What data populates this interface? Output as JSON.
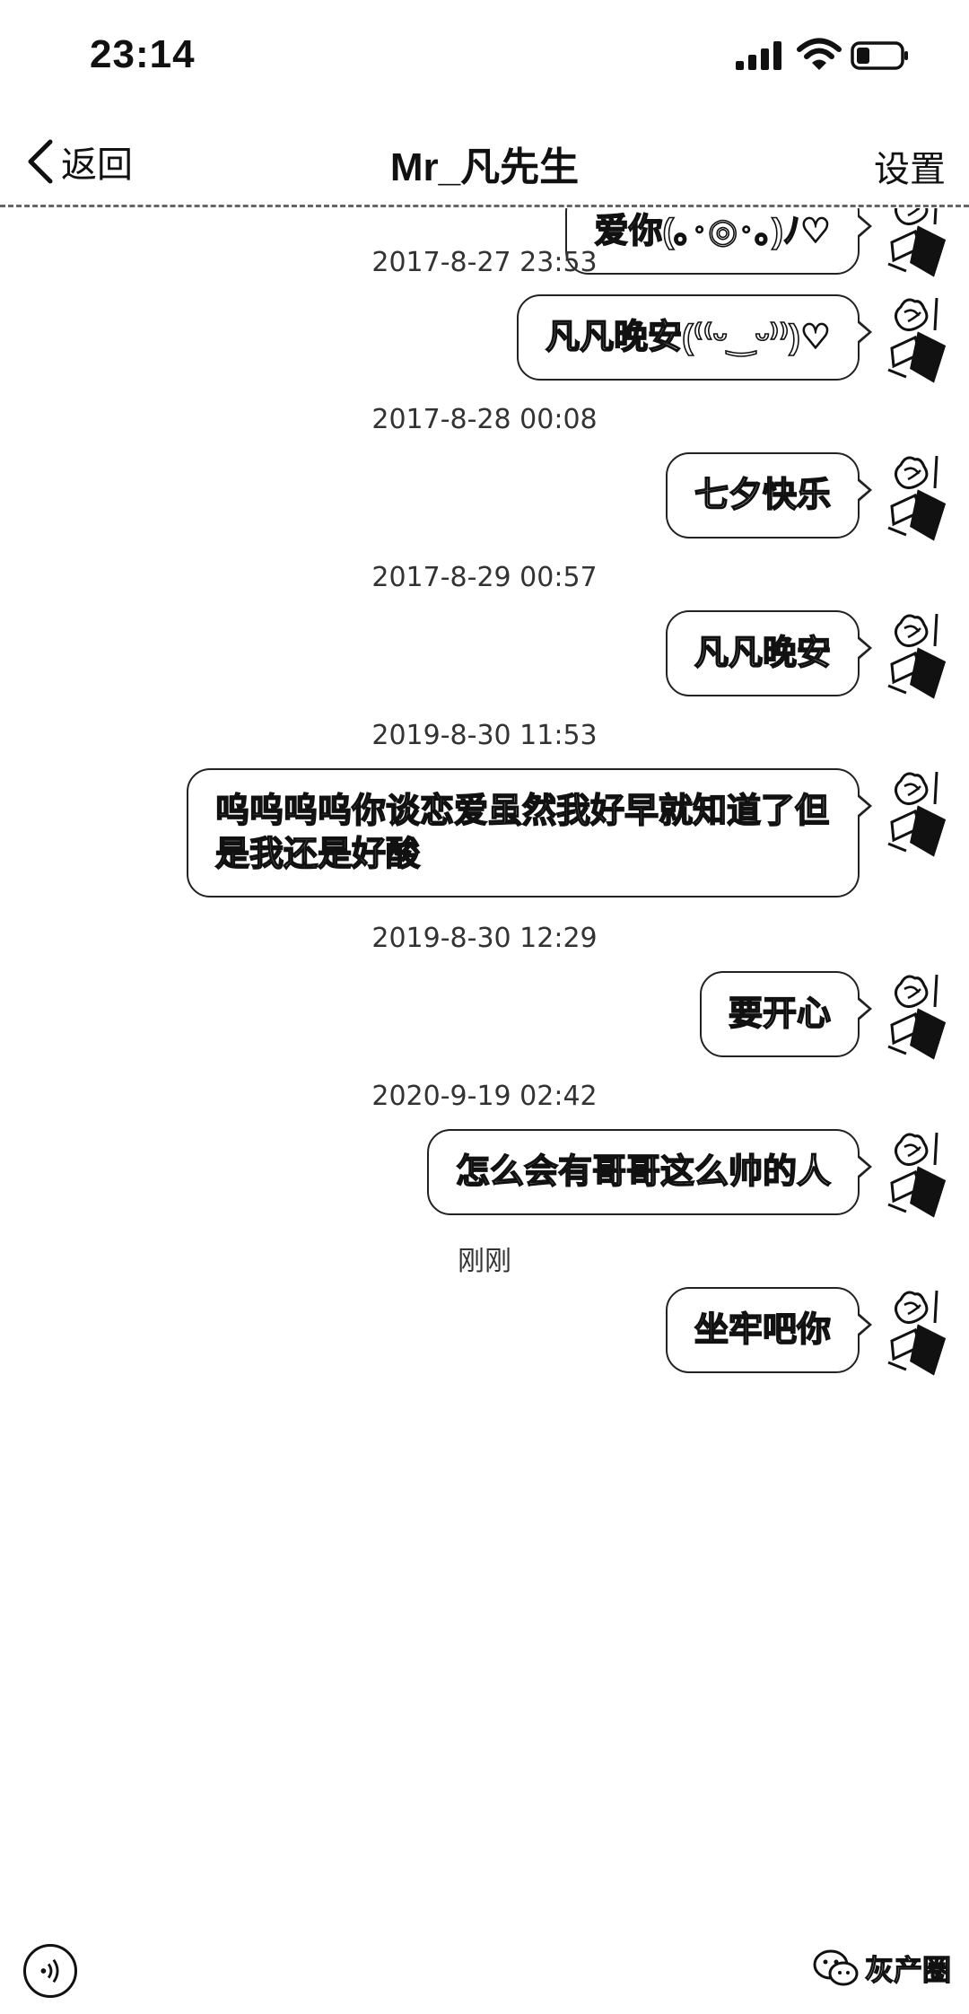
{
  "status_bar": {
    "time": "23:14"
  },
  "nav": {
    "back_label": "返回",
    "title": "Mr_凡先生",
    "settings_label": "设置"
  },
  "messages": [
    {
      "type": "bubble",
      "text": "爱你(｡･◎･｡)ﾉ♡"
    },
    {
      "type": "time",
      "text": "2017-8-27 23:53"
    },
    {
      "type": "bubble",
      "text": "凡凡晚安(⁽⁽ᵕ‿ᵕ⁾⁾)♡"
    },
    {
      "type": "time",
      "text": "2017-8-28 00:08"
    },
    {
      "type": "bubble",
      "text": "七夕快乐"
    },
    {
      "type": "time",
      "text": "2017-8-29 00:57"
    },
    {
      "type": "bubble",
      "text": "凡凡晚安"
    },
    {
      "type": "time",
      "text": "2019-8-30 11:53"
    },
    {
      "type": "bubble",
      "text": "呜呜呜呜你谈恋爱虽然我好早就知道了但是我还是好酸"
    },
    {
      "type": "time",
      "text": "2019-8-30 12:29"
    },
    {
      "type": "bubble",
      "text": "要开心"
    },
    {
      "type": "time",
      "text": "2020-9-19 02:42"
    },
    {
      "type": "bubble",
      "text": "怎么会有哥哥这么帅的人"
    },
    {
      "type": "time",
      "text": "刚刚"
    },
    {
      "type": "bubble",
      "text": "坐牢吧你"
    }
  ],
  "watermark": {
    "text": "灰产圈"
  },
  "icons": {
    "back": "chevron-left-icon",
    "signal": "signal-icon",
    "wifi": "wifi-icon",
    "battery": "battery-icon",
    "avatar": "rose-avatar",
    "voice": "voice-icon",
    "watermark": "wechat-icon"
  }
}
